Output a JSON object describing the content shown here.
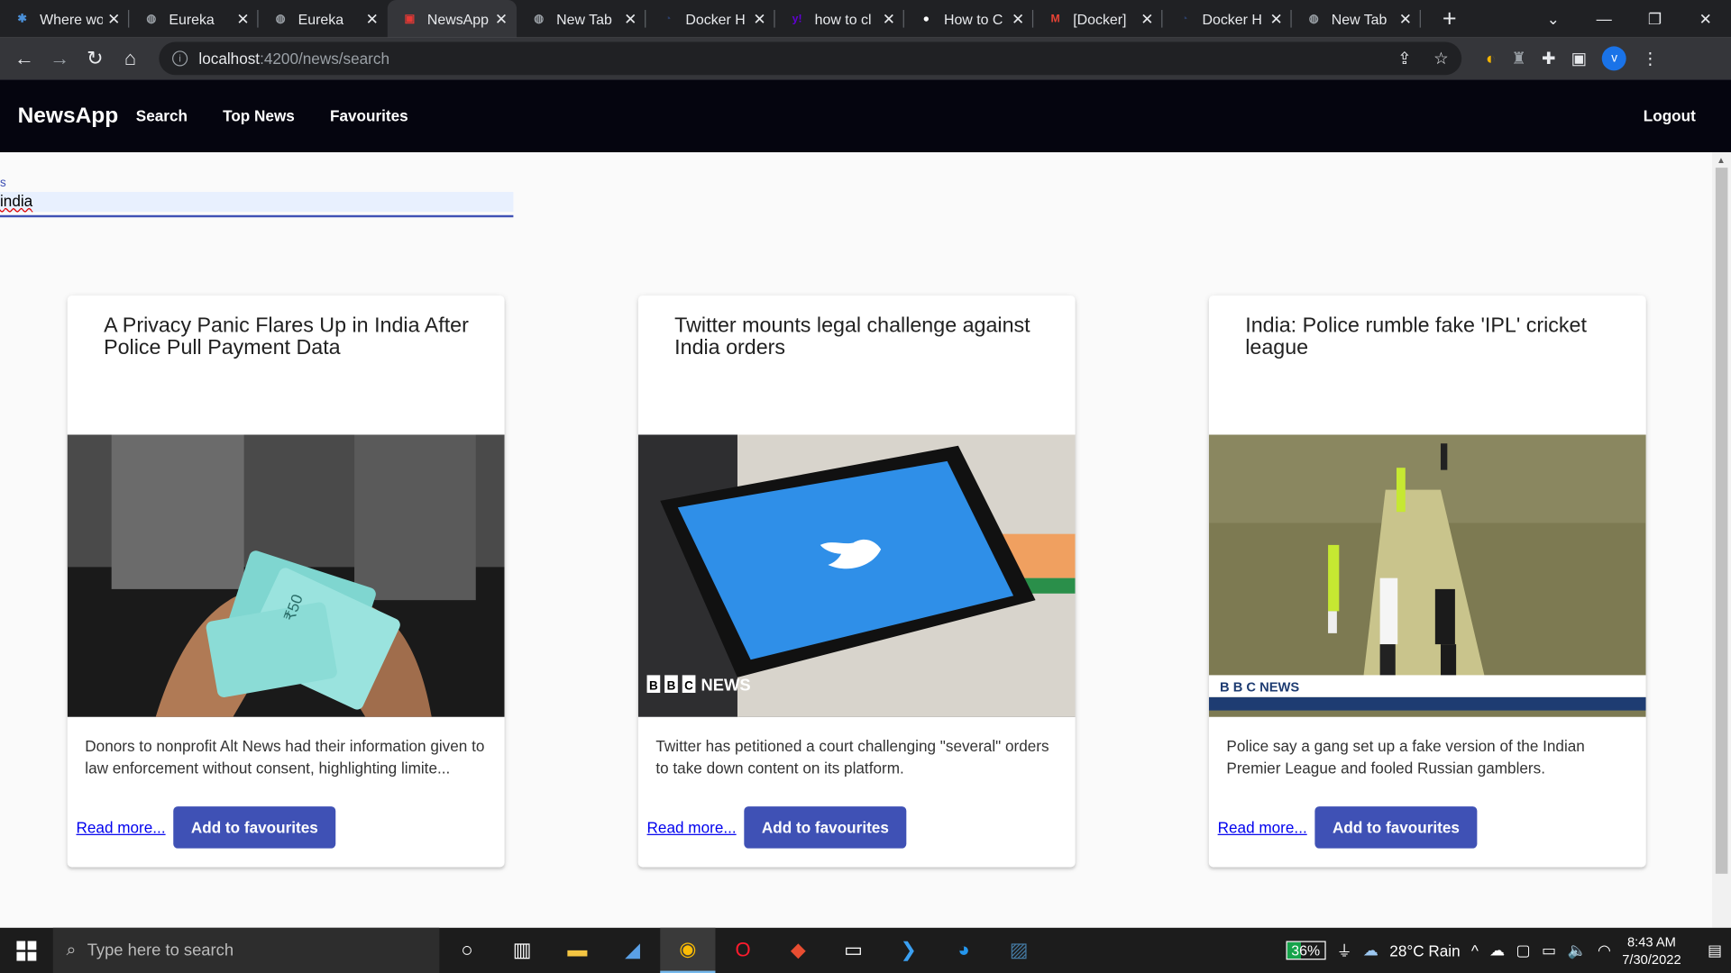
{
  "browser": {
    "tabs": [
      {
        "title": "Where wo",
        "favicon_color": "#4a90d9",
        "favicon_glyph": "✱"
      },
      {
        "title": "Eureka",
        "favicon_color": "#9aa0a6",
        "favicon_glyph": "◍"
      },
      {
        "title": "Eureka",
        "favicon_color": "#9aa0a6",
        "favicon_glyph": "◍"
      },
      {
        "title": "NewsApp",
        "favicon_color": "#e53935",
        "favicon_glyph": "▣"
      },
      {
        "title": "New Tab",
        "favicon_color": "#9aa0a6",
        "favicon_glyph": "◍"
      },
      {
        "title": "Docker H",
        "favicon_color": "#2c3e66",
        "favicon_glyph": "◔"
      },
      {
        "title": "how to cl",
        "favicon_color": "#6001d2",
        "favicon_glyph": "y!"
      },
      {
        "title": "How to C",
        "favicon_color": "#ffffff",
        "favicon_glyph": "●"
      },
      {
        "title": "[Docker]",
        "favicon_color": "#ea4335",
        "favicon_glyph": "M"
      },
      {
        "title": "Docker H",
        "favicon_color": "#2c3e66",
        "favicon_glyph": "◔"
      },
      {
        "title": "New Tab",
        "favicon_color": "#9aa0a6",
        "favicon_glyph": "◍"
      }
    ],
    "active_tab_index": 3,
    "url_host": "localhost",
    "url_path": ":4200/news/search",
    "profile_initial": "v"
  },
  "app": {
    "brand": "NewsApp",
    "nav": [
      "Search",
      "Top News",
      "Favourites"
    ],
    "logout": "Logout"
  },
  "search": {
    "label": "s",
    "value": "india"
  },
  "articles": [
    {
      "title": "A Privacy Panic Flares Up in India After Police Pull Payment Data",
      "description": "Donors to nonprofit Alt News had their information given to law enforcement without consent, highlighting limite...",
      "read_more": "Read more...",
      "favourite_button": "Add to favourites",
      "image": "hands-counting-rupee-notes"
    },
    {
      "title": "Twitter mounts legal challenge against India orders",
      "description": "Twitter has petitioned a court challenging \"several\" orders to take down content on its platform.",
      "read_more": "Read more...",
      "favourite_button": "Add to favourites",
      "image": "phone-twitter-logo",
      "image_watermark": "BBC NEWS"
    },
    {
      "title": "India: Police rumble fake 'IPL' cricket league",
      "description": "Police say a gang set up a fake version of the Indian Premier League and fooled Russian gamblers.",
      "read_more": "Read more...",
      "favourite_button": "Add to favourites",
      "image": "cricket-match-field",
      "image_watermark": "BBC NEWS"
    }
  ],
  "taskbar": {
    "search_placeholder": "Type here to search",
    "battery": "36%",
    "weather": "28°C  Rain",
    "time": "8:43 AM",
    "date": "7/30/2022"
  },
  "colors": {
    "primary": "#3f51b5",
    "navbar": "#05050f",
    "browser_dark": "#202124"
  }
}
